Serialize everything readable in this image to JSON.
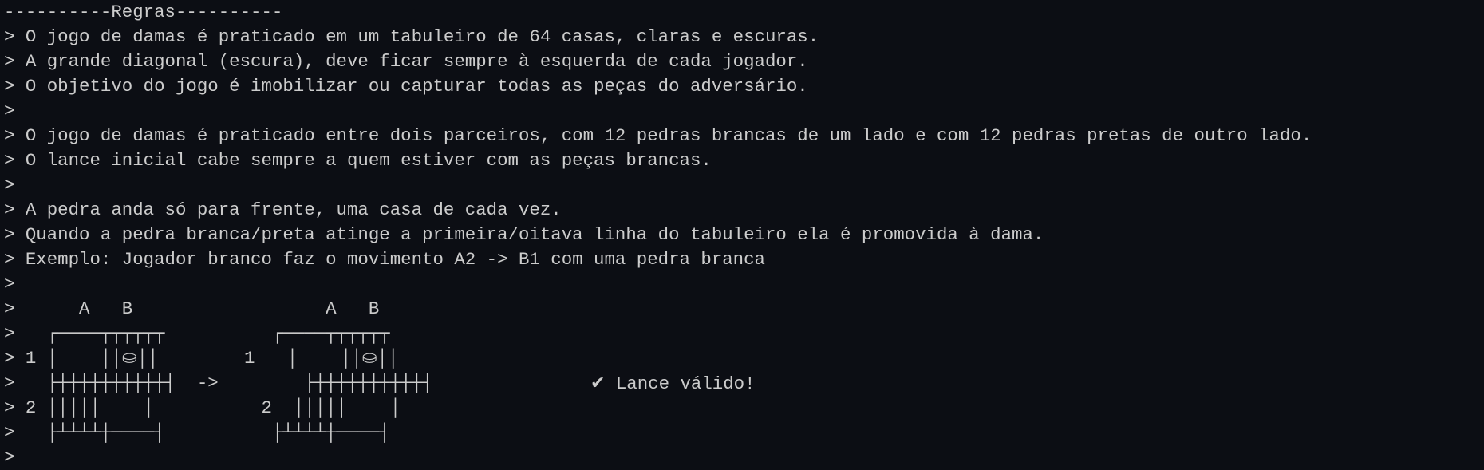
{
  "header": "----------Regras----------",
  "lines": [
    "> O jogo de damas é praticado em um tabuleiro de 64 casas, claras e escuras.",
    "> A grande diagonal (escura), deve ficar sempre à esquerda de cada jogador.",
    "> O objetivo do jogo é imobilizar ou capturar todas as peças do adversário.",
    ">",
    "> O jogo de damas é praticado entre dois parceiros, com 12 pedras brancas de um lado e com 12 pedras pretas de outro lado.",
    "> O lance inicial cabe sempre a quem estiver com as peças brancas.",
    ">",
    "> A pedra anda só para frente, uma casa de cada vez.",
    "> Quando a pedra branca/preta atinge a primeira/oitava linha do tabuleiro ela é promovida à dama.",
    "> Exemplo: Jogador branco faz o movimento A2 -> B1 com uma pedra branca",
    ">"
  ],
  "board_rows": [
    {
      "prompt": ">",
      "left": "      A   B",
      "gap": "                  ",
      "right": "A   B"
    },
    {
      "prompt": ">",
      "left": "   ┌────┬┬┬┬┬┬",
      "gap": "          ",
      "right": "┌────┬┬┬┬┬┬"
    },
    {
      "prompt": ">",
      "left": " 1 │    ││",
      "piece_left": "⛀",
      "left_end": "││",
      "gap": "        1   ",
      "right": "│    ││",
      "piece_right": "⛀",
      "right_end": "││"
    },
    {
      "prompt": ">",
      "left": "   ├┼┼┼┼┼┼┼┼┼┼┤",
      "gap": "  ->        ",
      "right": "├┼┼┼┼┼┼┼┼┼┼┤"
    },
    {
      "prompt": ">",
      "left": " 2 │││││    │",
      "gap": "          2  ",
      "right": "│││││    │"
    },
    {
      "prompt": ">",
      "left": "   ├┴┴┴┴┼────┤",
      "gap": "          ",
      "right": "├┴┴┴┴┼────┤"
    }
  ],
  "status": {
    "icon": "✔",
    "text": "Lance válido!"
  },
  "final_prompt": ">"
}
